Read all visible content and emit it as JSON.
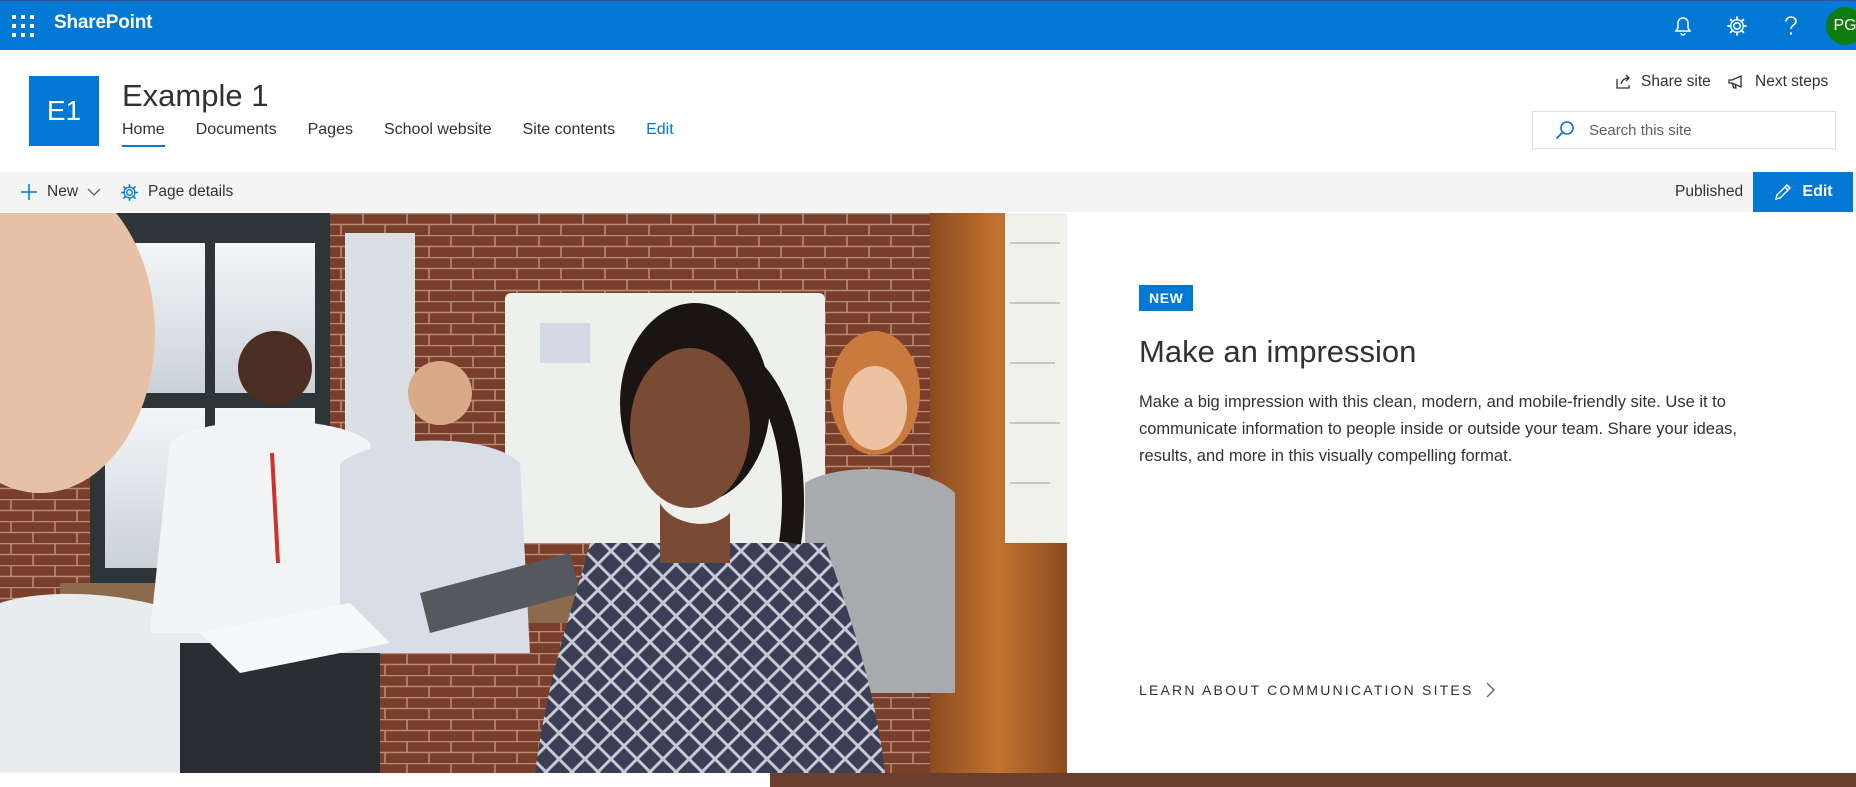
{
  "suitebar": {
    "brand": "SharePoint",
    "avatar_initials": "PG",
    "colors": {
      "bar": "#0078d4",
      "avatar": "#107c10"
    }
  },
  "site": {
    "logo_initials": "E1",
    "title": "Example 1",
    "nav": [
      {
        "label": "Home",
        "active": true
      },
      {
        "label": "Documents"
      },
      {
        "label": "Pages"
      },
      {
        "label": "School website"
      },
      {
        "label": "Site contents"
      },
      {
        "label": "Edit"
      }
    ],
    "share_label": "Share site",
    "next_steps_label": "Next steps",
    "search_placeholder": "Search this site"
  },
  "commandbar": {
    "new_label": "New",
    "page_details_label": "Page details",
    "status": "Published",
    "edit_label": "Edit"
  },
  "hero": {
    "badge": "NEW",
    "title": "Make an impression",
    "description": "Make a big impression with this clean, modern, and mobile-friendly site. Use it to communicate information to people inside or outside your team. Share your ideas, results, and more in this visually compelling format.",
    "link": "LEARN ABOUT COMMUNICATION SITES"
  },
  "icons": [
    "waffle-icon",
    "bell-icon",
    "gear-icon",
    "help-icon",
    "share-icon",
    "megaphone-icon",
    "search-icon",
    "plus-icon",
    "chevron-down-icon",
    "gear-icon",
    "pencil-icon",
    "chevron-right-icon"
  ]
}
